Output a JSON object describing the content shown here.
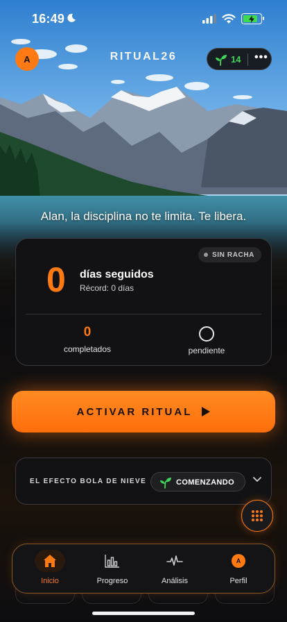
{
  "status_bar": {
    "time": "16:49"
  },
  "header": {
    "avatar_initial": "A",
    "title": "RITUAL26",
    "seeds_count": "14",
    "more_label": "•••"
  },
  "motto": "Alan, la disciplina no te limita. Te libera.",
  "streak_card": {
    "badge": "SIN RACHA",
    "days": "0",
    "days_label": "días seguidos",
    "record": "Récord: 0 días",
    "completed_value": "0",
    "completed_label": "completados",
    "pending_label": "pendiente"
  },
  "cta": {
    "label": "ACTIVAR RITUAL"
  },
  "snowball": {
    "title": "EL EFECTO BOLA DE NIEVE",
    "state": "COMENZANDO"
  },
  "tabbar": {
    "items": [
      {
        "label": "Inicio",
        "icon": "home-icon",
        "active": true
      },
      {
        "label": "Progreso",
        "icon": "bar-chart-icon"
      },
      {
        "label": "Análisis",
        "icon": "pulse-icon"
      },
      {
        "label": "Perfil",
        "icon": "avatar-icon",
        "initial": "A"
      }
    ]
  },
  "colors": {
    "accent": "#ff7a12",
    "seed_green": "#42d35a",
    "card_bg": "#121214"
  }
}
